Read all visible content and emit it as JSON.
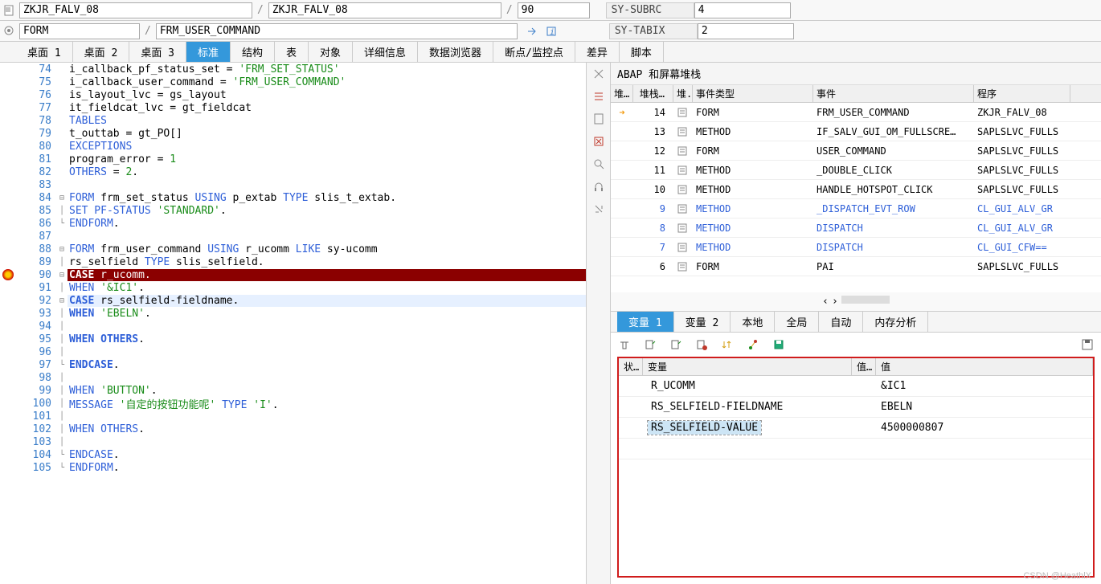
{
  "header": {
    "program1": "ZKJR_FALV_08",
    "program2": "ZKJR_FALV_08",
    "line_field": "90",
    "subrc_label": "SY-SUBRC",
    "subrc_value": "4",
    "form_label": "FORM",
    "form_name": "FRM_USER_COMMAND",
    "tabix_label": "SY-TABIX",
    "tabix_value": "2"
  },
  "tabs": [
    {
      "label": "桌面 1",
      "active": false
    },
    {
      "label": "桌面 2",
      "active": false
    },
    {
      "label": "桌面 3",
      "active": false
    },
    {
      "label": "标准",
      "active": true
    },
    {
      "label": "结构",
      "active": false
    },
    {
      "label": "表",
      "active": false
    },
    {
      "label": "对象",
      "active": false
    },
    {
      "label": "详细信息",
      "active": false
    },
    {
      "label": "数据浏览器",
      "active": false
    },
    {
      "label": "断点/监控点",
      "active": false
    },
    {
      "label": "差异",
      "active": false
    },
    {
      "label": "脚本",
      "active": false
    }
  ],
  "code": [
    {
      "n": 74,
      "fold": "",
      "html": "        i_callback_pf_status_set = <span class='str'>'FRM_SET_STATUS'</span>"
    },
    {
      "n": 75,
      "fold": "",
      "html": "        i_callback_user_command  = <span class='str'>'FRM_USER_COMMAND'</span>"
    },
    {
      "n": 76,
      "fold": "",
      "html": "        is_layout_lvc            = gs_layout"
    },
    {
      "n": 77,
      "fold": "",
      "html": "        it_fieldcat_lvc          = gt_fieldcat"
    },
    {
      "n": 78,
      "fold": "",
      "html": "      <span class='kw'>TABLES</span>"
    },
    {
      "n": 79,
      "fold": "",
      "html": "        t_outtab                 = gt_PO[]"
    },
    {
      "n": 80,
      "fold": "",
      "html": "      <span class='kw'>EXCEPTIONS</span>"
    },
    {
      "n": 81,
      "fold": "",
      "html": "        program_error            = <span class='num'>1</span>"
    },
    {
      "n": 82,
      "fold": "",
      "html": "        <span class='kw'>OTHERS</span>                   = <span class='num'>2</span>."
    },
    {
      "n": 83,
      "fold": "",
      "html": " "
    },
    {
      "n": 84,
      "fold": "⊟",
      "html": "  <span class='kw'>FORM</span> frm_set_status <span class='kw'>USING</span> p_extab <span class='kw'>TYPE</span> slis_t_extab."
    },
    {
      "n": 85,
      "fold": "│",
      "html": "    <span class='kw'>SET PF-STATUS</span> <span class='str'>'STANDARD'</span>."
    },
    {
      "n": 86,
      "fold": "└",
      "html": "  <span class='kw'>ENDFORM</span>."
    },
    {
      "n": 87,
      "fold": "",
      "html": " "
    },
    {
      "n": 88,
      "fold": "⊟",
      "html": "  <span class='kw'>FORM</span> frm_user_command <span class='kw'>USING</span> r_ucomm <span class='kw'>LIKE</span> sy-ucomm"
    },
    {
      "n": 89,
      "fold": "│",
      "html": "                              rs_selfield <span class='kw'>TYPE</span> slis_selfield."
    },
    {
      "n": 90,
      "fold": "⊟",
      "bp": true,
      "hl": "hl-red",
      "html": "    <span class='bold'>CASE</span> r_ucomm."
    },
    {
      "n": 91,
      "fold": "│",
      "html": "      <span class='kw'>WHEN</span> <span class='str'>'&IC1'</span>."
    },
    {
      "n": 92,
      "fold": "⊟",
      "hl": "hl-blue",
      "html": "        <span class='kw bold'>CASE</span> rs_selfield-fieldname."
    },
    {
      "n": 93,
      "fold": "│",
      "html": "          <span class='kw bold'>WHEN</span> <span class='str'>'EBELN'</span>."
    },
    {
      "n": 94,
      "fold": "│",
      "html": " "
    },
    {
      "n": 95,
      "fold": "│",
      "html": "          <span class='kw bold'>WHEN OTHERS</span>."
    },
    {
      "n": 96,
      "fold": "│",
      "html": " "
    },
    {
      "n": 97,
      "fold": "└",
      "html": "        <span class='kw bold'>ENDCASE</span>."
    },
    {
      "n": 98,
      "fold": "│",
      "html": " "
    },
    {
      "n": 99,
      "fold": "│",
      "html": "      <span class='kw'>WHEN</span> <span class='str'>'BUTTON'</span>."
    },
    {
      "n": 100,
      "fold": "│",
      "html": "        <span class='kw'>MESSAGE</span>  <span class='str'>'自定的按钮功能呢'</span> <span class='kw'>TYPE</span> <span class='str'>'I'</span>."
    },
    {
      "n": 101,
      "fold": "│",
      "html": " "
    },
    {
      "n": 102,
      "fold": "│",
      "html": "      <span class='kw'>WHEN OTHERS</span>."
    },
    {
      "n": 103,
      "fold": "│",
      "html": " "
    },
    {
      "n": 104,
      "fold": "└",
      "html": "    <span class='kw'>ENDCASE</span>."
    },
    {
      "n": 105,
      "fold": "└",
      "html": "  <span class='kw'>ENDFORM</span>."
    }
  ],
  "stack": {
    "title": "ABAP 和屏幕堆栈",
    "headers": {
      "ptr": "堆…",
      "depth": "堆栈…",
      "ico": "堆.",
      "type": "事件类型",
      "event": "事件",
      "prog": "程序"
    },
    "rows": [
      {
        "ptr": "➜",
        "depth": "14",
        "type": "FORM",
        "event": "FRM_USER_COMMAND",
        "prog": "ZKJR_FALV_08",
        "link": false
      },
      {
        "ptr": "",
        "depth": "13",
        "type": "METHOD",
        "event": "IF_SALV_GUI_OM_FULLSCRE…",
        "prog": "SAPLSLVC_FULLS",
        "link": false
      },
      {
        "ptr": "",
        "depth": "12",
        "type": "FORM",
        "event": "USER_COMMAND",
        "prog": "SAPLSLVC_FULLS",
        "link": false
      },
      {
        "ptr": "",
        "depth": "11",
        "type": "METHOD",
        "event": "_DOUBLE_CLICK",
        "prog": "SAPLSLVC_FULLS",
        "link": false
      },
      {
        "ptr": "",
        "depth": "10",
        "type": "METHOD",
        "event": "HANDLE_HOTSPOT_CLICK",
        "prog": "SAPLSLVC_FULLS",
        "link": false
      },
      {
        "ptr": "",
        "depth": "9",
        "type": "METHOD",
        "event": "_DISPATCH_EVT_ROW",
        "prog": "CL_GUI_ALV_GR",
        "link": true
      },
      {
        "ptr": "",
        "depth": "8",
        "type": "METHOD",
        "event": "DISPATCH",
        "prog": "CL_GUI_ALV_GR",
        "link": true
      },
      {
        "ptr": "",
        "depth": "7",
        "type": "METHOD",
        "event": "DISPATCH",
        "prog": "CL_GUI_CFW==",
        "link": true
      },
      {
        "ptr": "",
        "depth": "6",
        "type": "FORM",
        "event": "PAI",
        "prog": "SAPLSLVC_FULLS",
        "link": false
      }
    ]
  },
  "vars": {
    "tabs": [
      {
        "label": "变量 1",
        "active": true
      },
      {
        "label": "变量 2",
        "active": false
      },
      {
        "label": "本地",
        "active": false
      },
      {
        "label": "全局",
        "active": false
      },
      {
        "label": "自动",
        "active": false
      },
      {
        "label": "内存分析",
        "active": false
      }
    ],
    "headers": {
      "status": "状…",
      "name": "变量",
      "vico": "值…",
      "val": "值"
    },
    "rows": [
      {
        "name": "R_UCOMM",
        "val": "&IC1",
        "sel": false
      },
      {
        "name": "RS_SELFIELD-FIELDNAME",
        "val": "EBELN",
        "sel": false
      },
      {
        "name": "RS_SELFIELD-VALUE",
        "val": "4500000807",
        "sel": true
      },
      {
        "name": "",
        "val": "",
        "sel": false
      }
    ]
  },
  "watermark": "CSDN @HeathlX"
}
